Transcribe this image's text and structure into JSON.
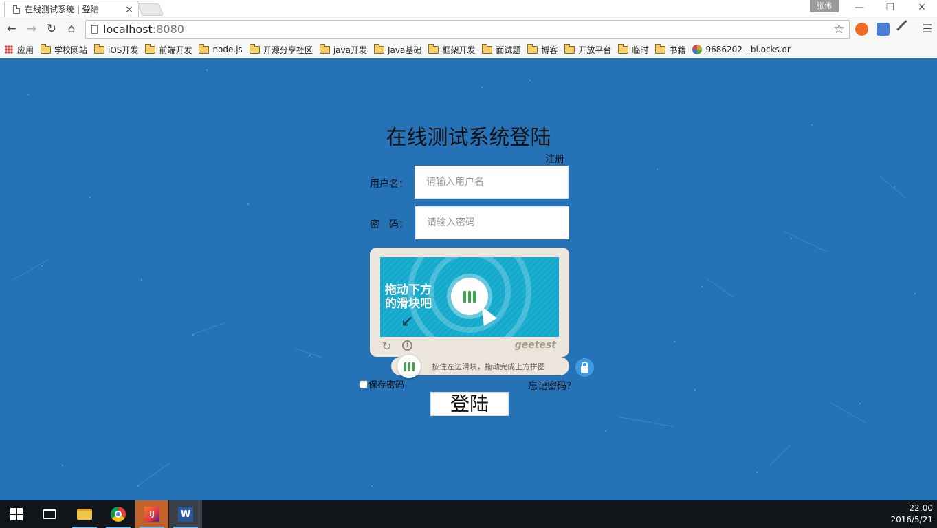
{
  "browser": {
    "tab_title": "在线测试系统 | 登陆",
    "tab_close": "×",
    "user_badge": "张伟",
    "window_controls": {
      "minimize": "—",
      "restore": "❐",
      "close": "✕"
    },
    "nav": {
      "back": "←",
      "forward": "→",
      "reload": "↻",
      "home": "⌂"
    },
    "url_host": "localhost",
    "url_port": ":8080",
    "bookmark_star": "☆",
    "bookmarks": [
      {
        "label": "应用",
        "icon": "apps-icon"
      },
      {
        "label": "学校网站",
        "icon": "folder-icon"
      },
      {
        "label": "iOS开发",
        "icon": "folder-icon"
      },
      {
        "label": "前端开发",
        "icon": "folder-icon"
      },
      {
        "label": "node.js",
        "icon": "folder-icon"
      },
      {
        "label": "开源分享社区",
        "icon": "folder-icon"
      },
      {
        "label": "java开发",
        "icon": "folder-icon"
      },
      {
        "label": "Java基础",
        "icon": "folder-icon"
      },
      {
        "label": "框架开发",
        "icon": "folder-icon"
      },
      {
        "label": "面试题",
        "icon": "folder-icon"
      },
      {
        "label": "博客",
        "icon": "folder-icon"
      },
      {
        "label": "开放平台",
        "icon": "folder-icon"
      },
      {
        "label": "临时",
        "icon": "folder-icon"
      },
      {
        "label": "书籍",
        "icon": "folder-icon"
      },
      {
        "label": "9686202 - bl.ocks.or",
        "icon": "globe-icon"
      }
    ]
  },
  "login": {
    "title": "在线测试系统登陆",
    "register_link": "注册",
    "username_label": "用户名：",
    "username_placeholder": "请输入用户名",
    "password_label": "密　码：",
    "password_placeholder": "请输入密码",
    "captcha": {
      "prompt_line1": "拖动下方",
      "prompt_line2": "的滑块吧",
      "refresh": "↻",
      "info": "!",
      "brand": "geetest",
      "slider_hint": "按住左边滑块，拖动完成上方拼图"
    },
    "remember_label": "保存密码",
    "forgot_link": "忘记密码？",
    "submit_label": "登陆"
  },
  "taskbar": {
    "time": "22:00",
    "date": "2016/5/21",
    "idea_label": "IJ",
    "word_label": "W"
  }
}
